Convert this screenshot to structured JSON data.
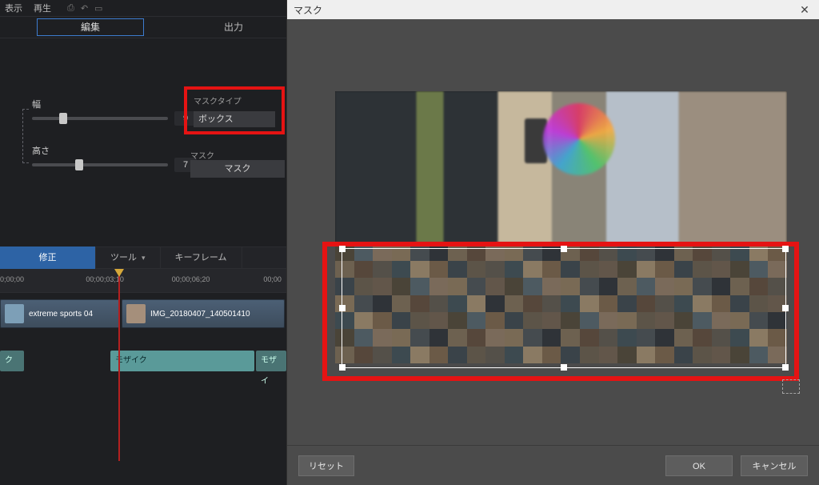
{
  "top_menu": {
    "display": "表示",
    "play": "再生"
  },
  "main_tabs": {
    "edit": "編集",
    "output": "出力"
  },
  "sliders": {
    "width": {
      "label": "幅",
      "value": "9",
      "thumb_pct": 20
    },
    "height": {
      "label": "高さ",
      "value": "7",
      "thumb_pct": 32
    }
  },
  "mask_type": {
    "label": "マスクタイプ",
    "value": "ボックス"
  },
  "mask_section": {
    "label": "マスク",
    "button": "マスク"
  },
  "midbar": {
    "fix": "修正",
    "tool": "ツール",
    "keyframe": "キーフレーム"
  },
  "ruler": {
    "ticks": [
      {
        "pct": 0,
        "label": "0;00;00"
      },
      {
        "pct": 30,
        "label": "00;00;03;10"
      },
      {
        "pct": 60,
        "label": "00;00;06;20"
      },
      {
        "pct": 92,
        "label": "00;00"
      }
    ],
    "playhead_pct": 42
  },
  "timeline": {
    "clips": [
      {
        "name": "extreme sports 04"
      },
      {
        "name": "IMG_20180407_140501410"
      }
    ],
    "fx": {
      "a": "ク",
      "b": "モザイク",
      "c": "モザイ"
    }
  },
  "dialog": {
    "title": "マスク",
    "reset": "リセット",
    "ok": "OK",
    "cancel": "キャンセル"
  }
}
